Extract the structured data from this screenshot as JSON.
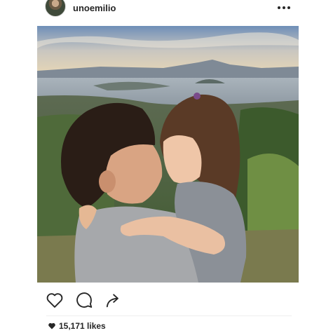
{
  "post": {
    "username": "unoemilio",
    "likes_text": "15,171 likes"
  },
  "icons": {
    "avatar": "profile-avatar",
    "more": "more-options-icon",
    "like": "heart-outline-icon",
    "comment": "comment-bubble-icon",
    "share": "share-arrow-icon",
    "likes_heart": "heart-filled-icon"
  },
  "photo": {
    "description_subject": "man and child nose to nose above lake landscape"
  },
  "colors": {
    "text": "#262626",
    "divider": "#efefef"
  }
}
